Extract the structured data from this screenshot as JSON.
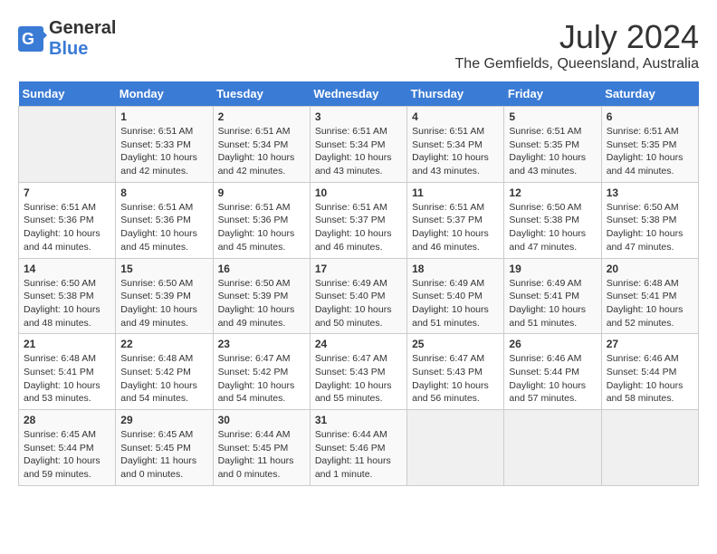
{
  "logo": {
    "general": "General",
    "blue": "Blue"
  },
  "title": "July 2024",
  "location": "The Gemfields, Queensland, Australia",
  "headers": [
    "Sunday",
    "Monday",
    "Tuesday",
    "Wednesday",
    "Thursday",
    "Friday",
    "Saturday"
  ],
  "weeks": [
    [
      {
        "day": "",
        "info": ""
      },
      {
        "day": "1",
        "info": "Sunrise: 6:51 AM\nSunset: 5:33 PM\nDaylight: 10 hours\nand 42 minutes."
      },
      {
        "day": "2",
        "info": "Sunrise: 6:51 AM\nSunset: 5:34 PM\nDaylight: 10 hours\nand 42 minutes."
      },
      {
        "day": "3",
        "info": "Sunrise: 6:51 AM\nSunset: 5:34 PM\nDaylight: 10 hours\nand 43 minutes."
      },
      {
        "day": "4",
        "info": "Sunrise: 6:51 AM\nSunset: 5:34 PM\nDaylight: 10 hours\nand 43 minutes."
      },
      {
        "day": "5",
        "info": "Sunrise: 6:51 AM\nSunset: 5:35 PM\nDaylight: 10 hours\nand 43 minutes."
      },
      {
        "day": "6",
        "info": "Sunrise: 6:51 AM\nSunset: 5:35 PM\nDaylight: 10 hours\nand 44 minutes."
      }
    ],
    [
      {
        "day": "7",
        "info": "Sunrise: 6:51 AM\nSunset: 5:36 PM\nDaylight: 10 hours\nand 44 minutes."
      },
      {
        "day": "8",
        "info": "Sunrise: 6:51 AM\nSunset: 5:36 PM\nDaylight: 10 hours\nand 45 minutes."
      },
      {
        "day": "9",
        "info": "Sunrise: 6:51 AM\nSunset: 5:36 PM\nDaylight: 10 hours\nand 45 minutes."
      },
      {
        "day": "10",
        "info": "Sunrise: 6:51 AM\nSunset: 5:37 PM\nDaylight: 10 hours\nand 46 minutes."
      },
      {
        "day": "11",
        "info": "Sunrise: 6:51 AM\nSunset: 5:37 PM\nDaylight: 10 hours\nand 46 minutes."
      },
      {
        "day": "12",
        "info": "Sunrise: 6:50 AM\nSunset: 5:38 PM\nDaylight: 10 hours\nand 47 minutes."
      },
      {
        "day": "13",
        "info": "Sunrise: 6:50 AM\nSunset: 5:38 PM\nDaylight: 10 hours\nand 47 minutes."
      }
    ],
    [
      {
        "day": "14",
        "info": "Sunrise: 6:50 AM\nSunset: 5:38 PM\nDaylight: 10 hours\nand 48 minutes."
      },
      {
        "day": "15",
        "info": "Sunrise: 6:50 AM\nSunset: 5:39 PM\nDaylight: 10 hours\nand 49 minutes."
      },
      {
        "day": "16",
        "info": "Sunrise: 6:50 AM\nSunset: 5:39 PM\nDaylight: 10 hours\nand 49 minutes."
      },
      {
        "day": "17",
        "info": "Sunrise: 6:49 AM\nSunset: 5:40 PM\nDaylight: 10 hours\nand 50 minutes."
      },
      {
        "day": "18",
        "info": "Sunrise: 6:49 AM\nSunset: 5:40 PM\nDaylight: 10 hours\nand 51 minutes."
      },
      {
        "day": "19",
        "info": "Sunrise: 6:49 AM\nSunset: 5:41 PM\nDaylight: 10 hours\nand 51 minutes."
      },
      {
        "day": "20",
        "info": "Sunrise: 6:48 AM\nSunset: 5:41 PM\nDaylight: 10 hours\nand 52 minutes."
      }
    ],
    [
      {
        "day": "21",
        "info": "Sunrise: 6:48 AM\nSunset: 5:41 PM\nDaylight: 10 hours\nand 53 minutes."
      },
      {
        "day": "22",
        "info": "Sunrise: 6:48 AM\nSunset: 5:42 PM\nDaylight: 10 hours\nand 54 minutes."
      },
      {
        "day": "23",
        "info": "Sunrise: 6:47 AM\nSunset: 5:42 PM\nDaylight: 10 hours\nand 54 minutes."
      },
      {
        "day": "24",
        "info": "Sunrise: 6:47 AM\nSunset: 5:43 PM\nDaylight: 10 hours\nand 55 minutes."
      },
      {
        "day": "25",
        "info": "Sunrise: 6:47 AM\nSunset: 5:43 PM\nDaylight: 10 hours\nand 56 minutes."
      },
      {
        "day": "26",
        "info": "Sunrise: 6:46 AM\nSunset: 5:44 PM\nDaylight: 10 hours\nand 57 minutes."
      },
      {
        "day": "27",
        "info": "Sunrise: 6:46 AM\nSunset: 5:44 PM\nDaylight: 10 hours\nand 58 minutes."
      }
    ],
    [
      {
        "day": "28",
        "info": "Sunrise: 6:45 AM\nSunset: 5:44 PM\nDaylight: 10 hours\nand 59 minutes."
      },
      {
        "day": "29",
        "info": "Sunrise: 6:45 AM\nSunset: 5:45 PM\nDaylight: 11 hours\nand 0 minutes."
      },
      {
        "day": "30",
        "info": "Sunrise: 6:44 AM\nSunset: 5:45 PM\nDaylight: 11 hours\nand 0 minutes."
      },
      {
        "day": "31",
        "info": "Sunrise: 6:44 AM\nSunset: 5:46 PM\nDaylight: 11 hours\nand 1 minute."
      },
      {
        "day": "",
        "info": ""
      },
      {
        "day": "",
        "info": ""
      },
      {
        "day": "",
        "info": ""
      }
    ]
  ]
}
